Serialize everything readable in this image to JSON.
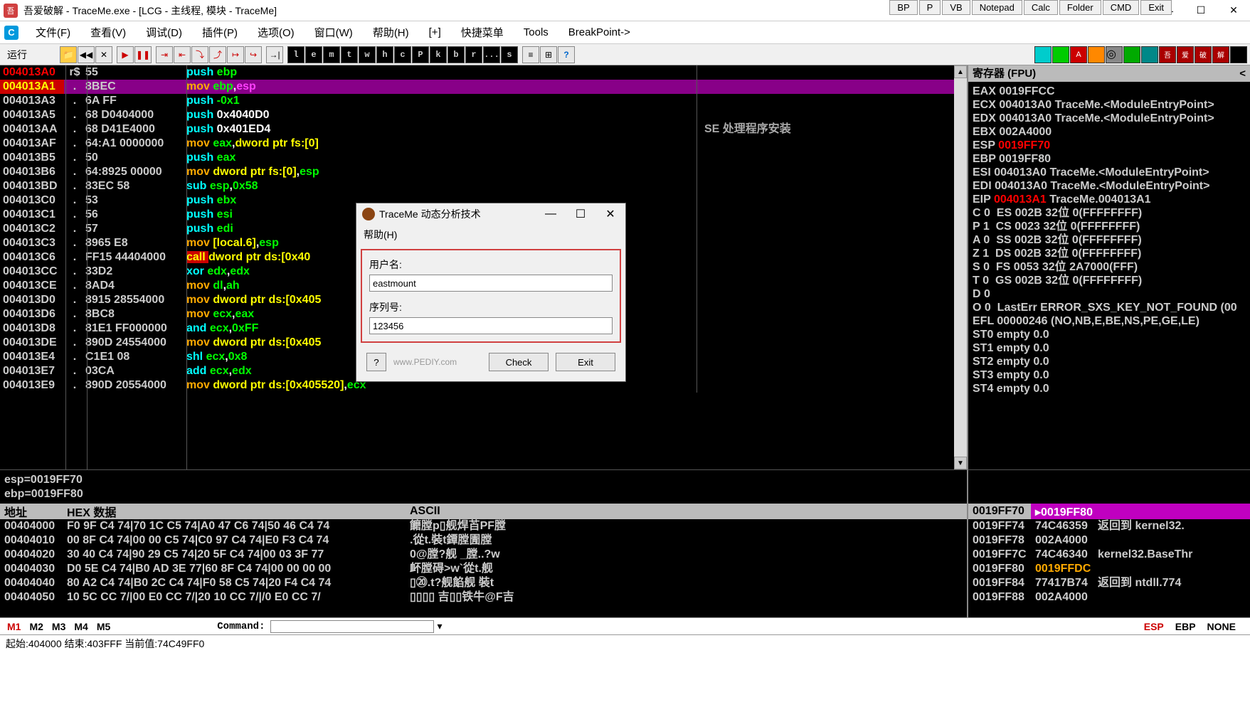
{
  "ext_buttons": [
    "BP",
    "P",
    "VB",
    "Notepad",
    "Calc",
    "Folder",
    "CMD",
    "Exit"
  ],
  "window": {
    "title": "吾爱破解 - TraceMe.exe - [LCG - 主线程, 模块 - TraceMe]"
  },
  "menu": [
    "文件(F)",
    "查看(V)",
    "调试(D)",
    "插件(P)",
    "选项(O)",
    "窗口(W)",
    "帮助(H)",
    "[+]",
    "快捷菜单",
    "Tools",
    "BreakPoint->"
  ],
  "toolbar": {
    "run": "运行",
    "letters": [
      "l",
      "e",
      "m",
      "t",
      "w",
      "h",
      "c",
      "P",
      "k",
      "b",
      "r",
      "...",
      "s"
    ]
  },
  "disasm": [
    {
      "addr": "004013A0",
      "dot": "r$",
      "bytes": "55",
      "instr": [
        [
          "push ",
          "c-cyan"
        ],
        [
          "ebp",
          "c-green"
        ]
      ],
      "bg": "bg-black",
      "addrcls": "c-red"
    },
    {
      "addr": "004013A1",
      "dot": ".",
      "bytes": "8BEC",
      "instr": [
        [
          "mov ",
          "c-gold"
        ],
        [
          "ebp",
          "c-green"
        ],
        [
          ",",
          "c-white"
        ],
        [
          "esp",
          "c-pink"
        ]
      ],
      "bg": "bg-purple",
      "addrcls": "bg-red c-yellow"
    },
    {
      "addr": "004013A3",
      "dot": ".",
      "bytes": "6A FF",
      "instr": [
        [
          "push ",
          "c-cyan"
        ],
        [
          "-0x1",
          "c-green"
        ]
      ],
      "addrcls": "c-gray"
    },
    {
      "addr": "004013A5",
      "dot": ".",
      "bytes": "68 D0404000",
      "instr": [
        [
          "push ",
          "c-cyan"
        ],
        [
          "0x4040D0",
          "c-white"
        ]
      ],
      "addrcls": "c-gray"
    },
    {
      "addr": "004013AA",
      "dot": ".",
      "bytes": "68 D41E4000",
      "instr": [
        [
          "push ",
          "c-cyan"
        ],
        [
          "0x401ED4",
          "c-white"
        ]
      ],
      "comment": "SE 处理程序安装",
      "addrcls": "c-gray"
    },
    {
      "addr": "004013AF",
      "dot": ".",
      "bytes": "64:A1 0000000",
      "instr": [
        [
          "mov ",
          "c-gold"
        ],
        [
          "eax",
          "c-green"
        ],
        [
          ",",
          "c-white"
        ],
        [
          "dword ptr fs:[0]",
          "c-yellow"
        ]
      ],
      "addrcls": "c-gray"
    },
    {
      "addr": "004013B5",
      "dot": ".",
      "bytes": "50",
      "instr": [
        [
          "push ",
          "c-cyan"
        ],
        [
          "eax",
          "c-green"
        ]
      ],
      "addrcls": "c-gray"
    },
    {
      "addr": "004013B6",
      "dot": ".",
      "bytes": "64:8925 00000",
      "instr": [
        [
          "mov ",
          "c-gold"
        ],
        [
          "dword ptr fs:[0]",
          "c-yellow"
        ],
        [
          ",",
          "c-white"
        ],
        [
          "esp",
          "c-green"
        ]
      ],
      "addrcls": "c-gray"
    },
    {
      "addr": "004013BD",
      "dot": ".",
      "bytes": "83EC 58",
      "instr": [
        [
          "sub ",
          "c-cyan"
        ],
        [
          "esp",
          "c-green"
        ],
        [
          ",",
          "c-white"
        ],
        [
          "0x58",
          "c-green"
        ]
      ],
      "addrcls": "c-gray"
    },
    {
      "addr": "004013C0",
      "dot": ".",
      "bytes": "53",
      "instr": [
        [
          "push ",
          "c-cyan"
        ],
        [
          "ebx",
          "c-green"
        ]
      ],
      "addrcls": "c-gray"
    },
    {
      "addr": "004013C1",
      "dot": ".",
      "bytes": "56",
      "instr": [
        [
          "push ",
          "c-cyan"
        ],
        [
          "esi",
          "c-green"
        ]
      ],
      "addrcls": "c-gray"
    },
    {
      "addr": "004013C2",
      "dot": ".",
      "bytes": "57",
      "instr": [
        [
          "push ",
          "c-cyan"
        ],
        [
          "edi",
          "c-green"
        ]
      ],
      "addrcls": "c-gray"
    },
    {
      "addr": "004013C3",
      "dot": ".",
      "bytes": "8965 E8",
      "instr": [
        [
          "mov ",
          "c-gold"
        ],
        [
          "[local.6]",
          "c-yellow"
        ],
        [
          ",",
          "c-white"
        ],
        [
          "esp",
          "c-green"
        ]
      ],
      "addrcls": "c-gray"
    },
    {
      "addr": "004013C6",
      "dot": ".",
      "bytes": "FF15 44404000",
      "instr": [
        [
          "call ",
          "bg-red c-yellow"
        ],
        [
          "dword ptr ds:[0x40",
          "c-yellow"
        ]
      ],
      "addrcls": "c-gray"
    },
    {
      "addr": "004013CC",
      "dot": ".",
      "bytes": "33D2",
      "instr": [
        [
          "xor ",
          "c-cyan"
        ],
        [
          "edx",
          "c-green"
        ],
        [
          ",",
          "c-white"
        ],
        [
          "edx",
          "c-green"
        ]
      ],
      "addrcls": "c-gray"
    },
    {
      "addr": "004013CE",
      "dot": ".",
      "bytes": "8AD4",
      "instr": [
        [
          "mov ",
          "c-gold"
        ],
        [
          "dl",
          "c-green"
        ],
        [
          ",",
          "c-white"
        ],
        [
          "ah",
          "c-green"
        ]
      ],
      "addrcls": "c-gray"
    },
    {
      "addr": "004013D0",
      "dot": ".",
      "bytes": "8915 28554000",
      "instr": [
        [
          "mov ",
          "c-gold"
        ],
        [
          "dword ptr ds:[0x405",
          "c-yellow"
        ]
      ],
      "addrcls": "c-gray"
    },
    {
      "addr": "004013D6",
      "dot": ".",
      "bytes": "8BC8",
      "instr": [
        [
          "mov ",
          "c-gold"
        ],
        [
          "ecx",
          "c-green"
        ],
        [
          ",",
          "c-white"
        ],
        [
          "eax",
          "c-green"
        ]
      ],
      "addrcls": "c-gray"
    },
    {
      "addr": "004013D8",
      "dot": ".",
      "bytes": "81E1 FF000000",
      "instr": [
        [
          "and ",
          "c-cyan"
        ],
        [
          "ecx",
          "c-green"
        ],
        [
          ",",
          "c-white"
        ],
        [
          "0xFF",
          "c-green"
        ]
      ],
      "addrcls": "c-gray"
    },
    {
      "addr": "004013DE",
      "dot": ".",
      "bytes": "890D 24554000",
      "instr": [
        [
          "mov ",
          "c-gold"
        ],
        [
          "dword ptr ds:[0x405",
          "c-yellow"
        ]
      ],
      "addrcls": "c-gray"
    },
    {
      "addr": "004013E4",
      "dot": ".",
      "bytes": "C1E1 08",
      "instr": [
        [
          "shl ",
          "c-cyan"
        ],
        [
          "ecx",
          "c-green"
        ],
        [
          ",",
          "c-white"
        ],
        [
          "0x8",
          "c-green"
        ]
      ],
      "addrcls": "c-gray"
    },
    {
      "addr": "004013E7",
      "dot": ".",
      "bytes": "03CA",
      "instr": [
        [
          "add ",
          "c-cyan"
        ],
        [
          "ecx",
          "c-green"
        ],
        [
          ",",
          "c-white"
        ],
        [
          "edx",
          "c-green"
        ]
      ],
      "addrcls": "c-gray"
    },
    {
      "addr": "004013E9",
      "dot": ".",
      "bytes": "890D 20554000",
      "instr": [
        [
          "mov ",
          "c-gold"
        ],
        [
          "dword ptr ds:[0x405520]",
          "c-yellow"
        ],
        [
          ",",
          "c-white"
        ],
        [
          "ecx",
          "c-green"
        ]
      ],
      "addrcls": "c-gray"
    }
  ],
  "registers": {
    "header": "寄存器 (FPU)",
    "lines": [
      "EAX 0019FFCC",
      "ECX 004013A0 TraceMe.<ModuleEntryPoint>",
      "EDX 004013A0 TraceMe.<ModuleEntryPoint>",
      "EBX 002A4000",
      "ESP |0019FF70",
      "EBP 0019FF80",
      "ESI 004013A0 TraceMe.<ModuleEntryPoint>",
      "EDI 004013A0 TraceMe.<ModuleEntryPoint>",
      "",
      "EIP |004013A1| TraceMe.004013A1",
      "",
      "C 0  ES 002B 32位 0(FFFFFFFF)",
      "P 1  CS 0023 32位 0(FFFFFFFF)",
      "A 0  SS 002B 32位 0(FFFFFFFF)",
      "Z 1  DS 002B 32位 0(FFFFFFFF)",
      "S 0  FS 0053 32位 2A7000(FFF)",
      "T 0  GS 002B 32位 0(FFFFFFFF)",
      "D 0",
      "O 0  LastErr ERROR_SXS_KEY_NOT_FOUND (00",
      "",
      "EFL 00000246 (NO,NB,E,BE,NS,PE,GE,LE)",
      "",
      "ST0 empty 0.0",
      "ST1 empty 0.0",
      "ST2 empty 0.0",
      "ST3 empty 0.0",
      "ST4 empty 0.0"
    ]
  },
  "info": {
    "line1": "esp=0019FF70",
    "line2": "ebp=0019FF80"
  },
  "dump": {
    "headers": {
      "addr": "地址",
      "hex": "HEX 数据",
      "ascii": "ASCII"
    },
    "rows": [
      {
        "a": "00404000",
        "h": "F0 9F C4 74|70 1C C5 74|A0 47 C6 74|50 46 C4 74",
        "s": "饝膛p▯舰焊苩PF膛"
      },
      {
        "a": "00404010",
        "h": "00 8F C4 74|00 00 C5 74|C0 97 C4 74|E0 F3 C4 74",
        "s": ".從t.裝t鐔膛圊膛"
      },
      {
        "a": "00404020",
        "h": "30 40 C4 74|90 29 C5 74|20 5F C4 74|00 03 3F 77",
        "s": "0@膛?舰 _膛..?w"
      },
      {
        "a": "00404030",
        "h": "D0 5E C4 74|B0 AD 3E 77|60 8F C4 74|00 00 00 00",
        "s": "衃膛碍>w`從t.舰"
      },
      {
        "a": "00404040",
        "h": "80 A2 C4 74|B0 2C C4 74|F0 58 C5 74|20 F4 C4 74",
        "s": "▯⑳.t?舰餡舰 裝t"
      },
      {
        "a": "00404050",
        "h": "10 5C CC 7/|00 E0 CC 7/|20 10 CC 7/|/0 E0 CC 7/",
        "s": "▯▯▯▯ 吉▯▯铁牛@F吉"
      }
    ]
  },
  "stack": {
    "h1": "0019FF70",
    "h2": "▸0019FF80",
    "rows": [
      {
        "a": "0019FF74",
        "v": "74C46359",
        "c": "返回到 kernel32."
      },
      {
        "a": "0019FF78",
        "v": "002A4000",
        "c": ""
      },
      {
        "a": "0019FF7C",
        "v": "74C46340",
        "c": "kernel32.BaseThr"
      },
      {
        "a": "0019FF80",
        "v": "0019FFDC",
        "c": "",
        "vcls": "c-gold"
      },
      {
        "a": "0019FF84",
        "v": "77417B74",
        "c": "返回到 ntdll.774"
      },
      {
        "a": "0019FF88",
        "v": "002A4000",
        "c": ""
      }
    ]
  },
  "cmd": {
    "tabs": [
      "M1",
      "M2",
      "M3",
      "M4",
      "M5"
    ],
    "label": "Command:",
    "right": [
      "ESP",
      "EBP",
      "NONE"
    ]
  },
  "status": "起始:404000 结束:403FFF 当前值:74C49FF0",
  "dialog": {
    "title": "TraceMe 动态分析技术",
    "menu": "帮助(H)",
    "user_label": "用户名:",
    "user_value": "eastmount",
    "serial_label": "序列号:",
    "serial_value": "123456",
    "link": "www.PEDIY.com",
    "check": "Check",
    "exit": "Exit",
    "q": "?"
  }
}
